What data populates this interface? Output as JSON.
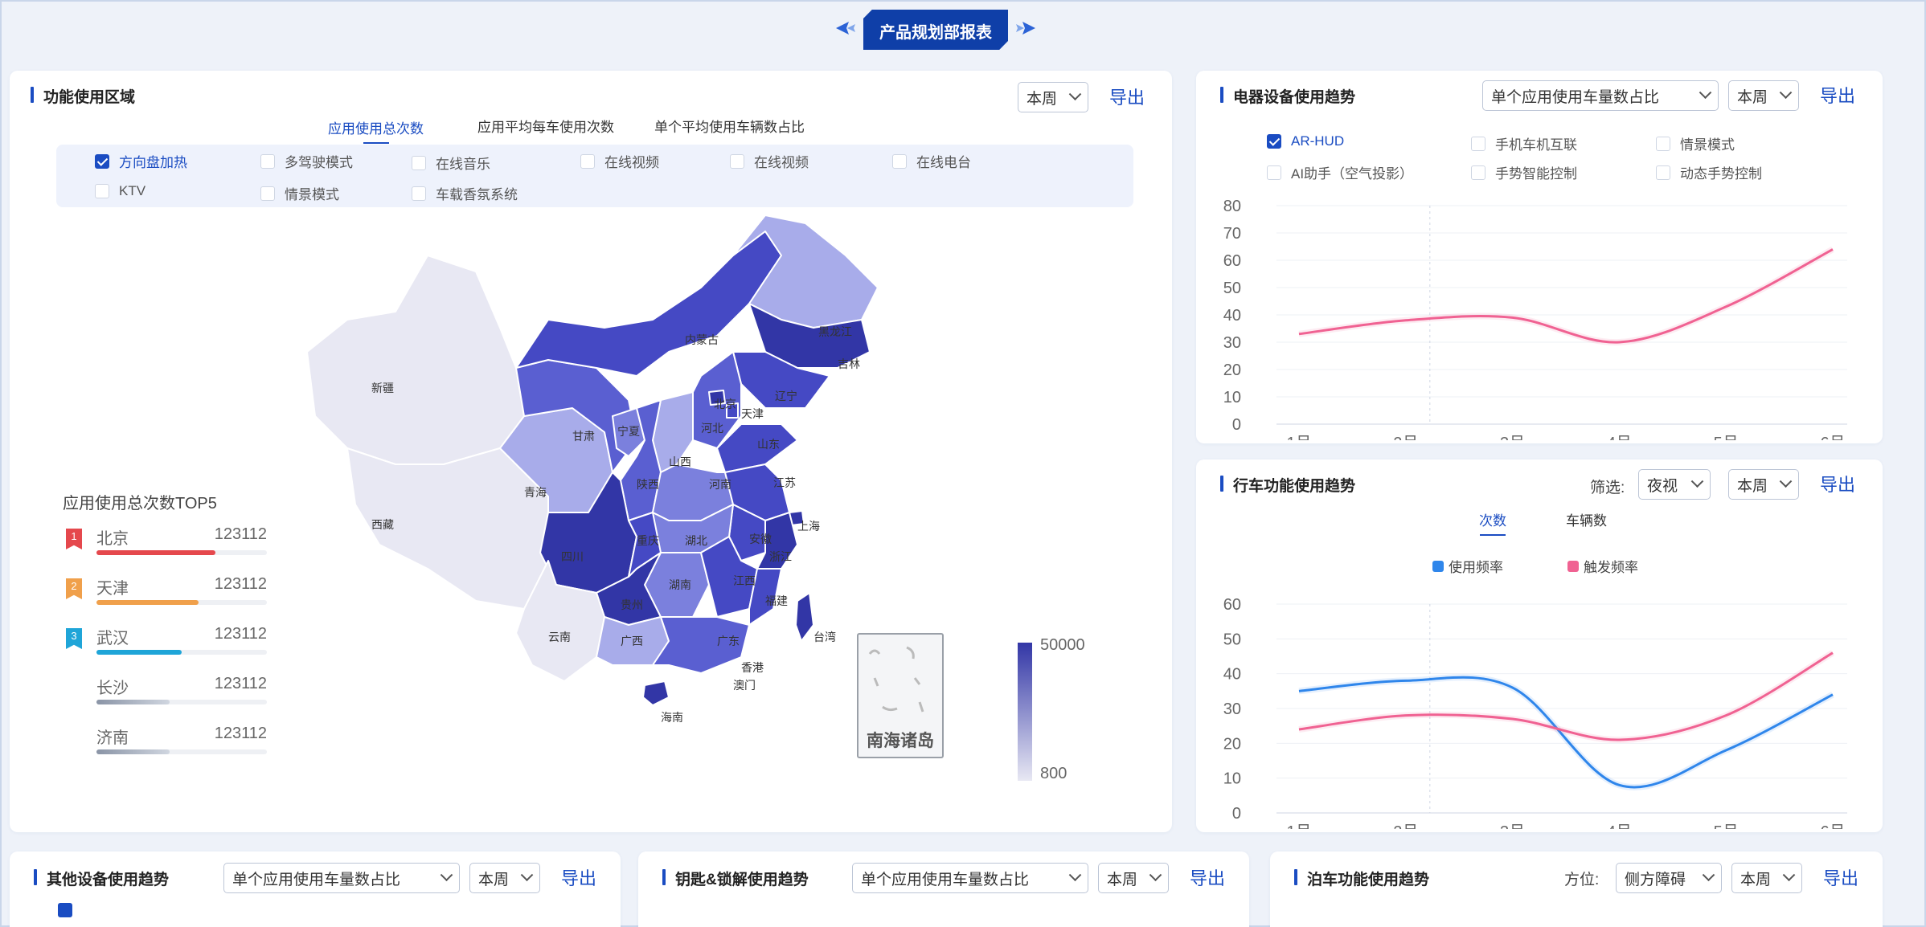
{
  "header": {
    "title": "产品规划部报表"
  },
  "feature_area": {
    "title": "功能使用区域",
    "period": "本周",
    "export_label": "导出",
    "tabs": [
      {
        "label": "应用使用总次数",
        "active": true
      },
      {
        "label": "应用平均每车使用次数",
        "active": false
      },
      {
        "label": "单个平均使用车辆数占比",
        "active": false
      }
    ],
    "options": [
      {
        "label": "方向盘加热",
        "checked": true
      },
      {
        "label": "多驾驶模式",
        "checked": false
      },
      {
        "label": "在线音乐",
        "checked": false
      },
      {
        "label": "在线视频",
        "checked": false
      },
      {
        "label": "在线视频",
        "checked": false
      },
      {
        "label": "在线电台",
        "checked": false
      },
      {
        "label": "KTV",
        "checked": false
      },
      {
        "label": "情景模式",
        "checked": false
      },
      {
        "label": "车载香氛系统",
        "checked": false
      }
    ],
    "ranking": {
      "title": "应用使用总次数TOP5",
      "items": [
        {
          "rank": "1",
          "city": "北京",
          "value": "123112",
          "color": "#e5484d",
          "fill": 0.7
        },
        {
          "rank": "2",
          "city": "天津",
          "value": "123112",
          "color": "#f0a04b",
          "fill": 0.6
        },
        {
          "rank": "3",
          "city": "武汉",
          "value": "123112",
          "color": "#1fa5d8",
          "fill": 0.5
        },
        {
          "rank": "",
          "city": "长沙",
          "value": "123112",
          "color": "#a9b3c4",
          "fill": 0.43
        },
        {
          "rank": "",
          "city": "济南",
          "value": "123112",
          "color": "#a9b3c4",
          "fill": 0.43
        }
      ]
    },
    "map_labels": [
      "新疆",
      "西藏",
      "青海",
      "甘肃",
      "内蒙古",
      "黑龙江",
      "吉林",
      "辽宁",
      "北京",
      "天津",
      "河北",
      "山西",
      "山东",
      "宁夏",
      "陕西",
      "河南",
      "江苏",
      "上海",
      "四川",
      "重庆",
      "湖北",
      "安徽",
      "浙江",
      "湖南",
      "江西",
      "福建",
      "贵州",
      "云南",
      "广西",
      "广东",
      "台湾",
      "香港",
      "澳门",
      "海南"
    ],
    "south_sea_label": "南海诸岛",
    "legend": {
      "max": "50000",
      "min": "800"
    },
    "colors": {
      "low": "#e8e8f3",
      "high": "#3236a6"
    }
  },
  "appliance_trend": {
    "title": "电器设备使用趋势",
    "metric_select": "单个应用使用车量数占比",
    "period": "本周",
    "export_label": "导出",
    "options": [
      {
        "label": "AR-HUD",
        "checked": true
      },
      {
        "label": "手机车机互联",
        "checked": false
      },
      {
        "label": "情景模式",
        "checked": false
      },
      {
        "label": "AI助手（空气投影）",
        "checked": false
      },
      {
        "label": "手势智能控制",
        "checked": false
      },
      {
        "label": "动态手势控制",
        "checked": false
      }
    ],
    "chart_data": {
      "type": "line",
      "categories": [
        "1月",
        "2月",
        "3月",
        "4月",
        "5月",
        "6月"
      ],
      "ylim": [
        0,
        80
      ],
      "yticks": [
        "0",
        "10",
        "20",
        "30",
        "40",
        "50",
        "60",
        "70",
        "80"
      ],
      "series": [
        {
          "color": "#f06292",
          "values": [
            33,
            38,
            39,
            30,
            43,
            64
          ]
        }
      ]
    }
  },
  "driving_trend": {
    "title": "行车功能使用趋势",
    "filter_label": "筛选:",
    "filter_value": "夜视",
    "period": "本周",
    "export_label": "导出",
    "tabs": [
      {
        "label": "次数",
        "active": true
      },
      {
        "label": "车辆数",
        "active": false
      }
    ],
    "chart_data": {
      "type": "line",
      "categories": [
        "1月",
        "2月",
        "3月",
        "4月",
        "5月",
        "6月"
      ],
      "ylim": [
        0,
        60
      ],
      "yticks": [
        "0",
        "10",
        "20",
        "30",
        "40",
        "50",
        "60"
      ],
      "series": [
        {
          "name": "使用频率",
          "color": "#2f86eb",
          "values": [
            35,
            38,
            36,
            8,
            18,
            34
          ]
        },
        {
          "name": "触发频率",
          "color": "#f06292",
          "values": [
            24,
            28,
            27,
            21,
            28,
            46
          ]
        }
      ]
    }
  },
  "other_devices": {
    "title": "其他设备使用趋势",
    "metric_select": "单个应用使用车量数占比",
    "period": "本周",
    "export_label": "导出"
  },
  "key_unlock": {
    "title": "钥匙&锁解使用趋势",
    "metric_select": "单个应用使用车量数占比",
    "period": "本周",
    "export_label": "导出"
  },
  "parking": {
    "title": "泊车功能使用趋势",
    "direction_label": "方位:",
    "direction_value": "侧方障碍",
    "period": "本周",
    "export_label": "导出"
  }
}
